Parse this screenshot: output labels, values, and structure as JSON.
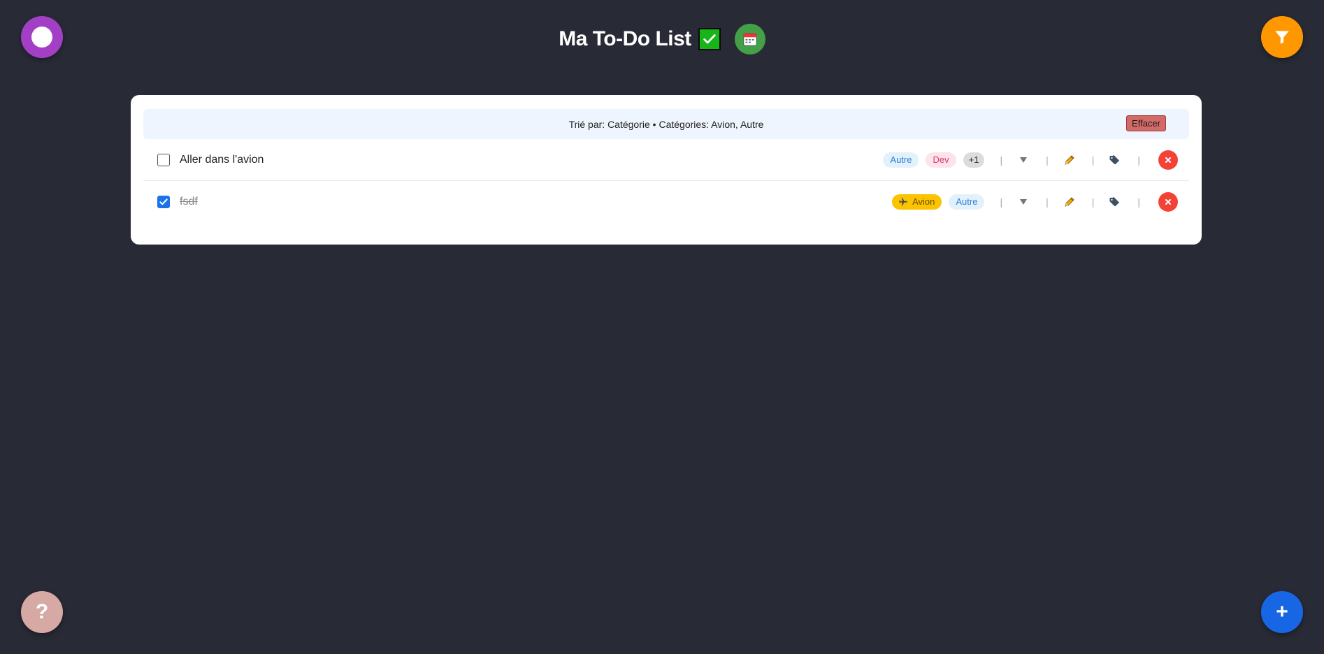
{
  "header": {
    "title": "Ma To-Do List"
  },
  "filter_bar": {
    "text": "Trié par: Catégorie • Catégories: Avion, Autre",
    "clear_label": "Effacer"
  },
  "tasks": [
    {
      "text": "Aller dans l'avion",
      "completed": false,
      "tags": [
        "Autre",
        "Dev"
      ],
      "more_tags": "+1"
    },
    {
      "text": "fsdf",
      "completed": true,
      "tags": [
        "Avion",
        "Autre"
      ]
    }
  ],
  "controls": {
    "expand_glyph": "▼",
    "separator": "|",
    "help_label": "?",
    "add_label": "+"
  },
  "colors": {
    "background": "#282a36",
    "theme_button": "#a23fc5",
    "filter_button": "#ff9800",
    "help_button": "#d7a9a4",
    "add_button": "#1767e5",
    "delete_button": "#f44336",
    "calendar_button": "#43a047"
  },
  "icons": {
    "theme": "circle-icon",
    "filter": "funnel-icon",
    "calendar": "calendar-icon",
    "title_emoji": "check-mark-icon",
    "edit": "pencil-icon",
    "tags": "tags-icon",
    "delete": "close-icon",
    "plane": "plane-icon"
  }
}
